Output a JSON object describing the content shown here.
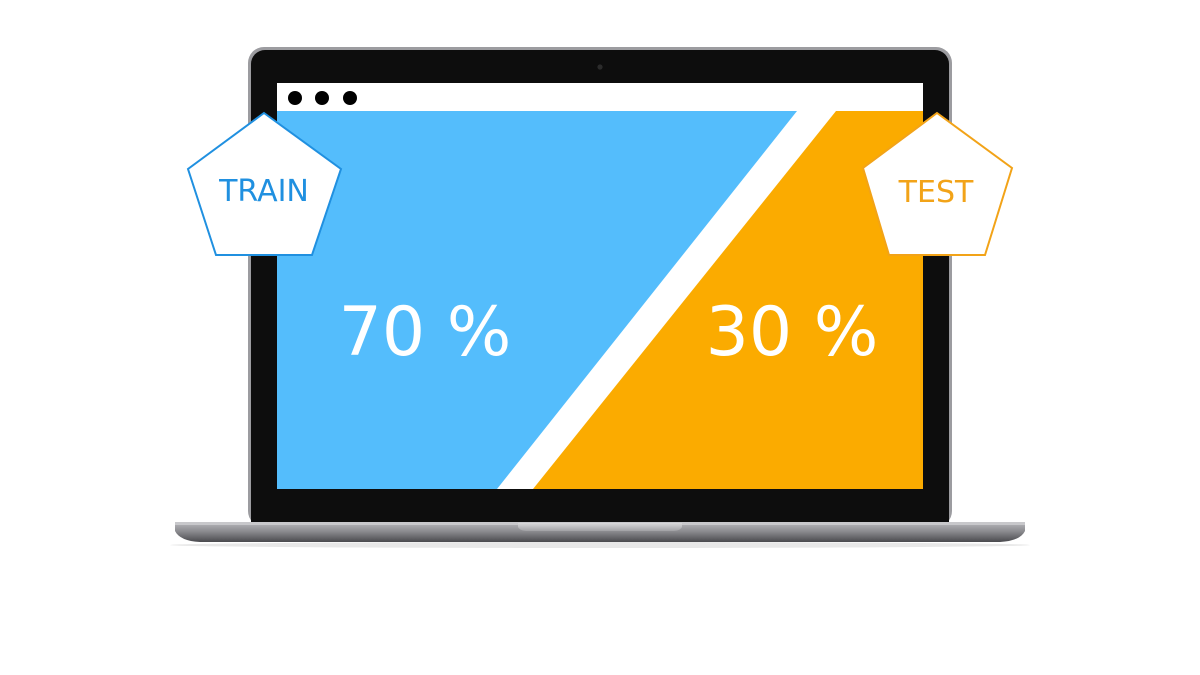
{
  "colors": {
    "train": "#54bdfc",
    "train_accent": "#2090e0",
    "test": "#fbab00",
    "test_accent": "#f2a318",
    "laptop_bezel": "#0d0d0d",
    "laptop_base": "#8a8a8e",
    "background": "#ffffff"
  },
  "browser": {
    "dots": [
      "window-dot",
      "window-dot",
      "window-dot"
    ]
  },
  "split": {
    "train": {
      "label": "TRAIN",
      "value_text": "70 %",
      "value": 70
    },
    "test": {
      "label": "TEST",
      "value_text": "30 %",
      "value": 30
    }
  }
}
